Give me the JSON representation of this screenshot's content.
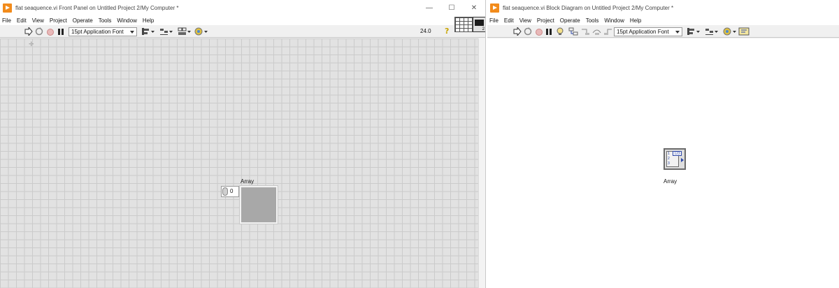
{
  "front_panel": {
    "title": "flat seaquence.vi Front Panel on Untitled Project 2/My Computer *",
    "window_controls": {
      "minimize": "—",
      "maximize": "☐",
      "close": "✕"
    },
    "menu": [
      "File",
      "Edit",
      "View",
      "Project",
      "Operate",
      "Tools",
      "Window",
      "Help"
    ],
    "toolbar": {
      "font": "15pt Application Font",
      "value": "24.0",
      "help": "?",
      "icon_number": "2"
    },
    "array": {
      "label": "Array",
      "index": "0"
    }
  },
  "block_diagram": {
    "title": "flat seaquence.vi Block Diagram on Untitled Project 2/My Computer *",
    "menu": [
      "File",
      "Edit",
      "View",
      "Project",
      "Operate",
      "Tools",
      "Window",
      "Help"
    ],
    "toolbar": {
      "font": "15pt Application Font"
    },
    "terminal": {
      "label": "Array",
      "type_text": "123"
    }
  },
  "colors": {
    "labview_orange": "#f28b1b",
    "canvas_grid": "#e2e2e2",
    "array_element": "#a8a8a8",
    "terminal_blue": "#2b46a8"
  }
}
